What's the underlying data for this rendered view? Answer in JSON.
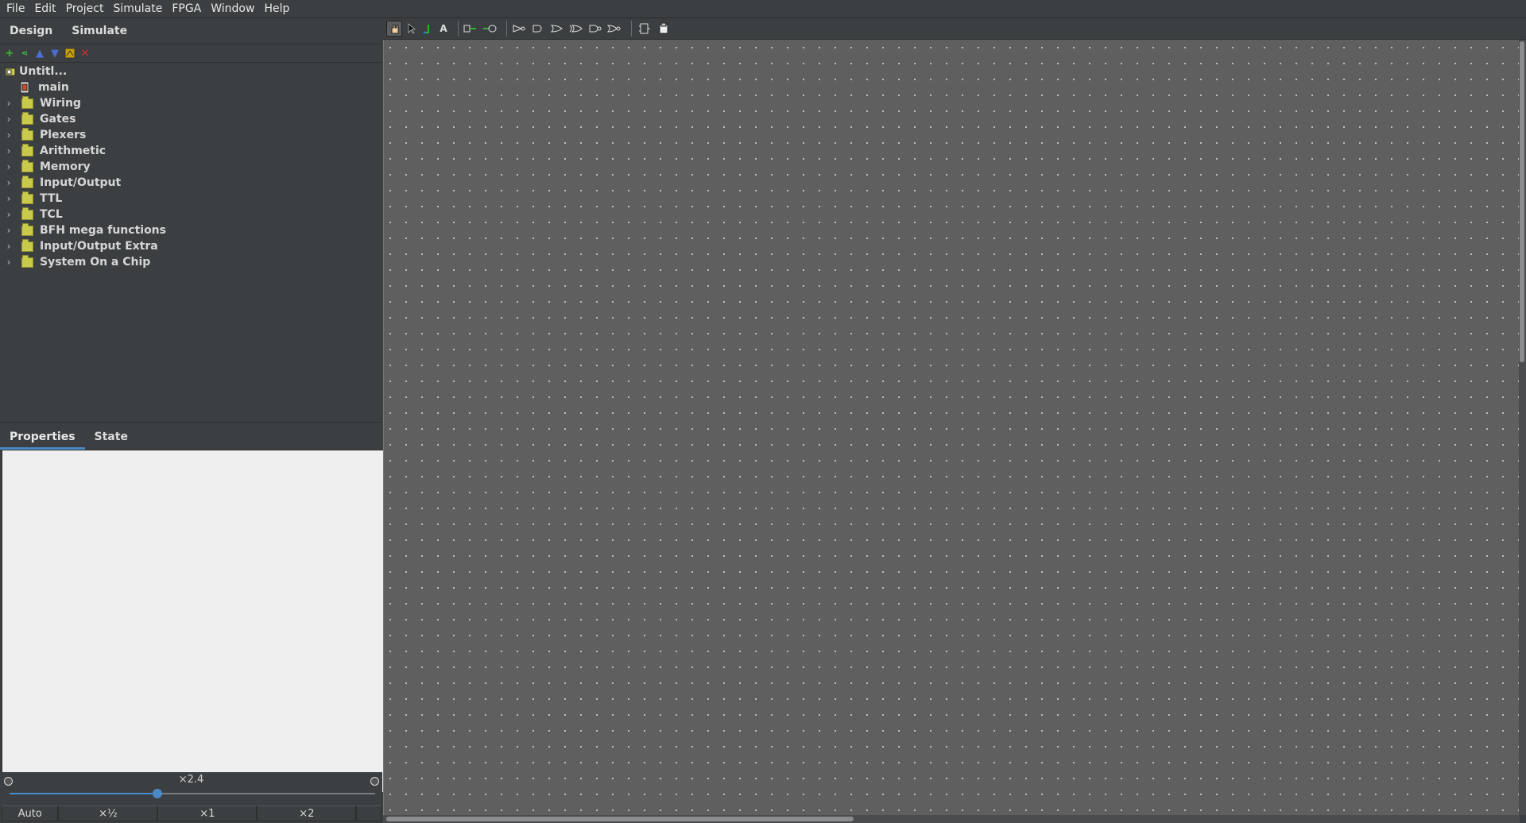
{
  "menu": [
    "File",
    "Edit",
    "Project",
    "Simulate",
    "FPGA",
    "Window",
    "Help"
  ],
  "left_tabs": {
    "design": "Design",
    "simulate": "Simulate"
  },
  "tree": {
    "project": "Untitl...",
    "circuit": "main",
    "libraries": [
      "Wiring",
      "Gates",
      "Plexers",
      "Arithmetic",
      "Memory",
      "Input/Output",
      "TTL",
      "TCL",
      "BFH mega functions",
      "Input/Output Extra",
      "System On a Chip"
    ]
  },
  "props_tabs": {
    "properties": "Properties",
    "state": "State"
  },
  "zoom": {
    "label": "×2.4",
    "value": 2.4,
    "slider_fraction": 0.4,
    "buttons": [
      "Auto",
      "×½",
      "×1",
      "×2"
    ]
  },
  "colors": {
    "accent": "#4a88c7",
    "canvas": "#5f5f5f",
    "panel": "#3c3f41"
  }
}
